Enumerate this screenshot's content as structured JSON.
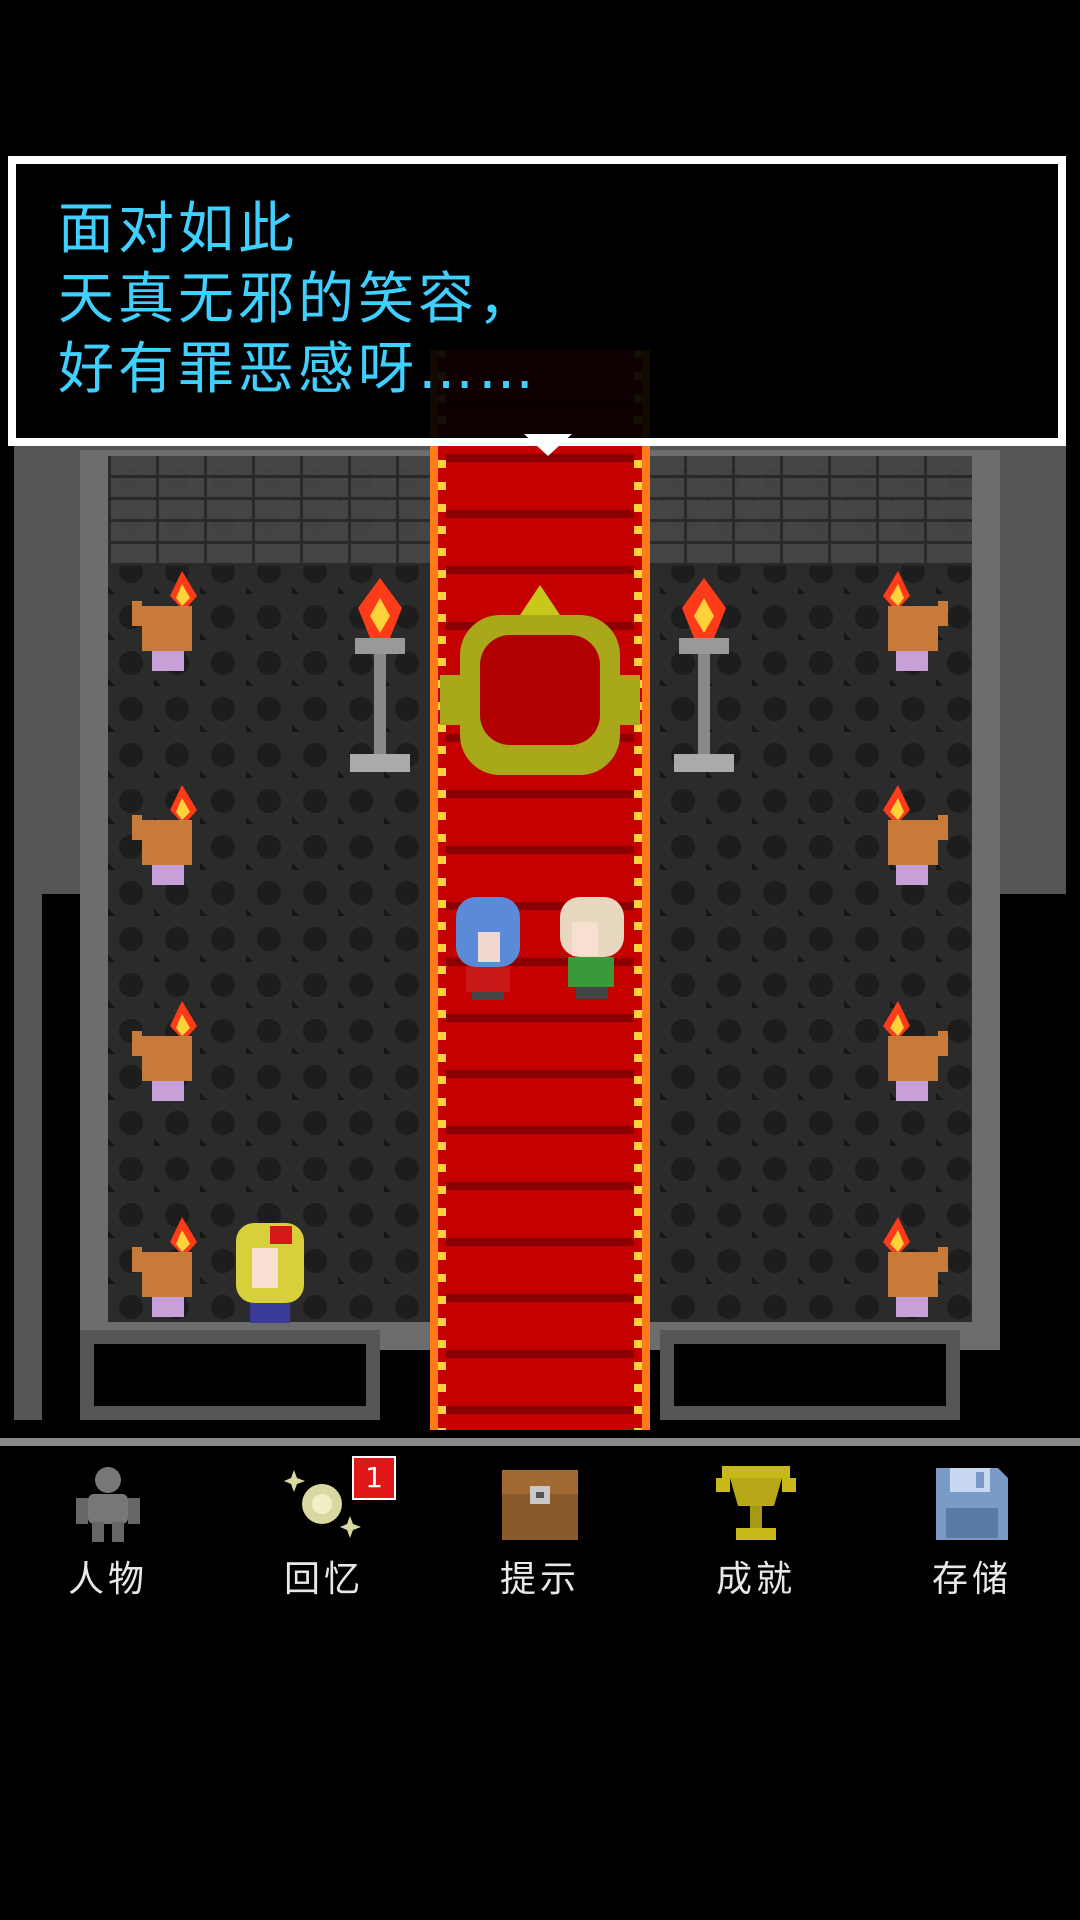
{
  "dialog": {
    "lines": [
      "面对如此",
      "天真无邪的笑容，",
      "好有罪恶感呀……"
    ]
  },
  "menu": {
    "items": [
      {
        "label": "人物",
        "icon": "person-icon"
      },
      {
        "label": "回忆",
        "icon": "memory-sparkle-icon",
        "badge": "1"
      },
      {
        "label": "提示",
        "icon": "treasure-chest-icon"
      },
      {
        "label": "成就",
        "icon": "trophy-icon"
      },
      {
        "label": "存储",
        "icon": "floppy-disk-icon"
      }
    ]
  },
  "colors": {
    "dialog_text": "#3fd0ff",
    "carpet": "#c40000",
    "badge": "#e01818"
  }
}
